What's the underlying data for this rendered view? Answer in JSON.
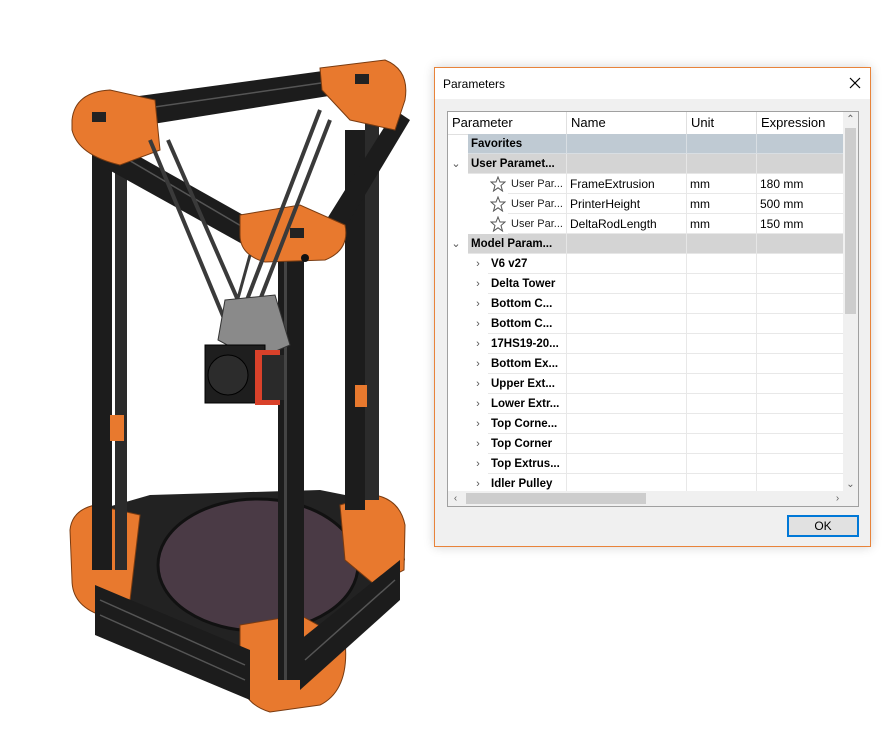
{
  "dialog": {
    "title": "Parameters",
    "ok_label": "OK"
  },
  "columns": [
    "Parameter",
    "Name",
    "Unit",
    "Expression"
  ],
  "groups": {
    "favorites": "Favorites",
    "user": "User Paramet...",
    "model": "Model Param..."
  },
  "user_params": [
    {
      "param": "User Par...",
      "name": "FrameExtrusion",
      "unit": "mm",
      "expression": "180 mm"
    },
    {
      "param": "User Par...",
      "name": "PrinterHeight",
      "unit": "mm",
      "expression": "500 mm"
    },
    {
      "param": "User Par...",
      "name": "DeltaRodLength",
      "unit": "mm",
      "expression": "150 mm"
    }
  ],
  "model_components": [
    "V6 v27",
    "Delta Tower",
    "Bottom C...",
    "Bottom C...",
    "17HS19-20...",
    "Bottom Ex...",
    "Upper Ext...",
    "Lower Extr...",
    "Top Corne...",
    "Top Corner",
    "Top Extrus...",
    "Idler Pulley"
  ],
  "colors": {
    "printer_orange": "#e8792e",
    "printer_frame": "#1c1c1c",
    "print_bed": "#4a3a45",
    "favorites_row": "#bfcad3",
    "group_row": "#d4d4d4",
    "dialog_border": "#e8833a",
    "ok_border": "#0078d7"
  },
  "icons": {
    "close": "close-icon",
    "favorite": "star-icon",
    "expand": "chevron-right-icon",
    "collapse": "chevron-down-icon"
  }
}
